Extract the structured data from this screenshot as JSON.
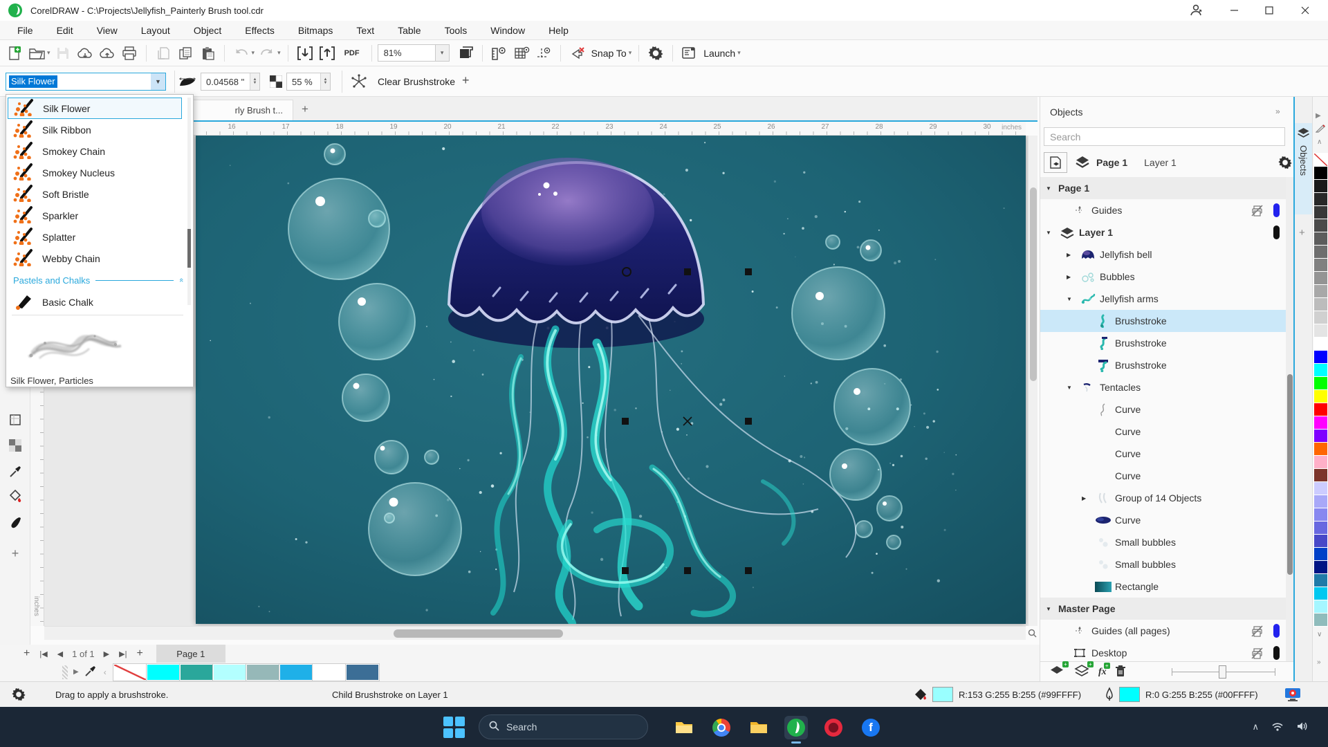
{
  "titlebar": {
    "title": "CorelDRAW - C:\\Projects\\Jellyfish_Painterly Brush tool.cdr"
  },
  "menus": [
    "File",
    "Edit",
    "View",
    "Layout",
    "Object",
    "Effects",
    "Bitmaps",
    "Text",
    "Table",
    "Tools",
    "Window",
    "Help"
  ],
  "toolbar": {
    "zoom": "81%",
    "snap": "Snap To",
    "launch": "Launch",
    "pdf": "PDF"
  },
  "property_bar": {
    "brush": "Silk Flower",
    "nib_size": "0.04568 \"",
    "transparency": "55 %",
    "clear": "Clear Brushstroke"
  },
  "brush_list": {
    "items": [
      "Silk Flower",
      "Silk Ribbon",
      "Smokey Chain",
      "Smokey Nucleus",
      "Soft Bristle",
      "Sparkler",
      "Splatter",
      "Webby Chain"
    ],
    "selected_index": 0,
    "section": "Pastels and Chalks",
    "section_items": [
      "Basic Chalk"
    ],
    "caption": "Silk Flower, Particles"
  },
  "doc_tab": "rly Brush t...",
  "rulers": {
    "unit": "inches",
    "h_start": 16,
    "h_end": 30
  },
  "objects": {
    "title": "Objects",
    "search": "Search",
    "page": "Page 1",
    "layer": "Layer 1",
    "tab": "Objects",
    "tree": [
      {
        "label": "Page 1",
        "level": 0,
        "arrow": "down",
        "group": true
      },
      {
        "label": "Guides",
        "level": 1,
        "icon": "guides",
        "printer": true,
        "pill": "#2222ee"
      },
      {
        "label": "Layer 1",
        "level": 0,
        "arrow": "down",
        "icon": "layers",
        "bold": true,
        "pill": "#111111"
      },
      {
        "label": "Jellyfish bell",
        "level": 2,
        "arrow": "right",
        "icon": "bell"
      },
      {
        "label": "Bubbles",
        "level": 2,
        "arrow": "right",
        "icon": "bubbles"
      },
      {
        "label": "Jellyfish arms",
        "level": 2,
        "arrow": "down",
        "icon": "arms"
      },
      {
        "label": "Brushstroke",
        "level": 3,
        "icon": "stroke1",
        "selected": true
      },
      {
        "label": "Brushstroke",
        "level": 3,
        "icon": "stroke2"
      },
      {
        "label": "Brushstroke",
        "level": 3,
        "icon": "stroke3"
      },
      {
        "label": "Tentacles",
        "level": 2,
        "arrow": "down",
        "icon": "tentacles"
      },
      {
        "label": "Curve",
        "level": 3,
        "icon": "curve"
      },
      {
        "label": "Curve",
        "level": 3,
        "icon": "blank"
      },
      {
        "label": "Curve",
        "level": 3,
        "icon": "blank"
      },
      {
        "label": "Curve",
        "level": 3,
        "icon": "blank"
      },
      {
        "label": "Group of 14 Objects",
        "level": 3,
        "arrow": "right",
        "icon": "group14"
      },
      {
        "label": "Curve",
        "level": 3,
        "icon": "blob"
      },
      {
        "label": "Small bubbles",
        "level": 3,
        "icon": "faint"
      },
      {
        "label": "Small bubbles",
        "level": 3,
        "icon": "faint"
      },
      {
        "label": "Rectangle",
        "level": 3,
        "icon": "gradrect"
      },
      {
        "label": "Master Page",
        "level": 0,
        "arrow": "down",
        "group": true
      },
      {
        "label": "Guides (all pages)",
        "level": 1,
        "icon": "guides",
        "printer": true,
        "pill": "#2222ee"
      },
      {
        "label": "Desktop",
        "level": 1,
        "icon": "desktop",
        "printer": true,
        "pill": "#111111"
      }
    ]
  },
  "navigator": {
    "pages": "1 of 1",
    "tab": "Page 1"
  },
  "status": {
    "hint": "Drag to apply a brushstroke.",
    "context": "Child Brushstroke on Layer 1",
    "fill_text": "R:153 G:255 B:255 (#99FFFF)",
    "fill_hex": "#99FFFF",
    "outline_text": "R:0 G:255 B:255 (#00FFFF)",
    "outline_hex": "#00FFFF"
  },
  "taskbar": {
    "search": "Search"
  },
  "palette_main": [
    "none",
    "#000000",
    "#1a1a1a",
    "#282828",
    "#383838",
    "#4a4a4a",
    "#5c5c5c",
    "#6e6e6e",
    "#808080",
    "#949494",
    "#a8a8a8",
    "#bcbcbc",
    "#d0d0d0",
    "#e4e4e4",
    "#ffffff",
    "#0000ff",
    "#00ffff",
    "#00ff00",
    "#ffff00",
    "#ff0000",
    "#ff00ff",
    "#7f00ff",
    "#ff6600",
    "#ffb0c8",
    "#7c352b",
    "#ccccff",
    "#a8a8f8",
    "#8888f0",
    "#6868e0",
    "#4848c8",
    "#0040c8",
    "#001484",
    "#1f7aa8",
    "#00c8f0",
    "#a5f6ff",
    "#8fbcbc"
  ],
  "palette_document": [
    "none",
    "#00ffff",
    "#2aa79b",
    "#b3ffff",
    "#96b8b8",
    "#1fb0e8",
    "#ffffff",
    "#3c6e96"
  ]
}
